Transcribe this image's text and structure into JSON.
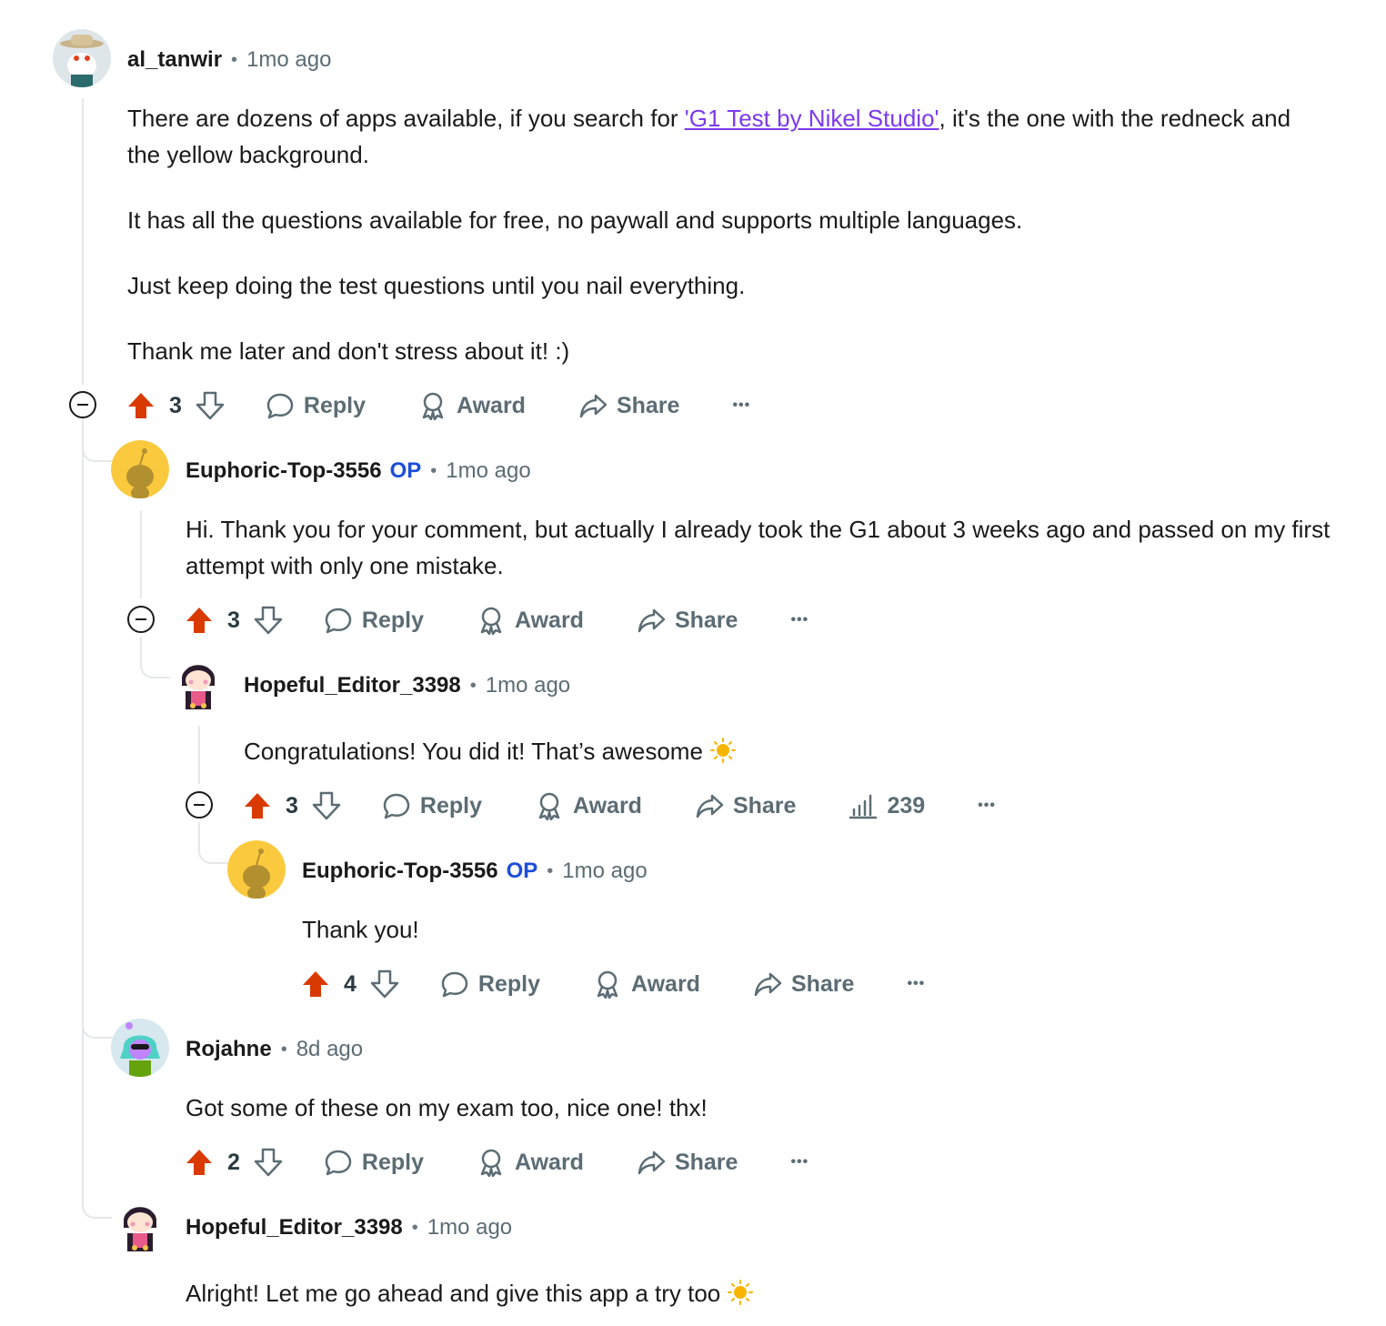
{
  "comments": [
    {
      "username": "al_tanwir",
      "time": "1mo ago",
      "body_1_pre": "There are dozens of apps available, if you search for ",
      "body_1_link": "'G1 Test by Nikel Studio'",
      "body_1_post": ", it's the one with the redneck and the yellow background.",
      "body_2": "It has all the questions available for free, no paywall and supports multiple languages.",
      "body_3": "Just keep doing the test questions until you nail everything.",
      "body_4": "Thank me later and don't stress about it! :)",
      "votes": "3"
    },
    {
      "username": "Euphoric-Top-3556",
      "op": "OP",
      "time": "1mo ago",
      "body": "Hi. Thank you for your comment, but actually I already took the G1 about 3 weeks ago and passed on my first attempt with only one mistake.",
      "votes": "3"
    },
    {
      "username": "Hopeful_Editor_3398",
      "time": "1mo ago",
      "body": "Congratulations! You did it! That’s awesome",
      "votes": "3",
      "views": "239"
    },
    {
      "username": "Euphoric-Top-3556",
      "op": "OP",
      "time": "1mo ago",
      "body": "Thank you!",
      "votes": "4"
    },
    {
      "username": "Rojahne",
      "time": "8d ago",
      "body": "Got some of these on my exam too, nice one! thx!",
      "votes": "2"
    },
    {
      "username": "Hopeful_Editor_3398",
      "time": "1mo ago",
      "body": "Alright! Let me go ahead and give this app a try too"
    }
  ],
  "labels": {
    "reply": "Reply",
    "award": "Award",
    "share": "Share",
    "more": "•••"
  },
  "colors": {
    "upvote_active": "#d93a00",
    "op_badge": "#1d4ed8",
    "link": "#7c3aed",
    "meta_gray": "#5c6c74"
  },
  "icons": [
    "upvote-icon",
    "downvote-icon",
    "reply-icon",
    "award-icon",
    "share-icon",
    "more-icon",
    "collapse-icon",
    "views-icon",
    "sun-emoji-icon"
  ]
}
